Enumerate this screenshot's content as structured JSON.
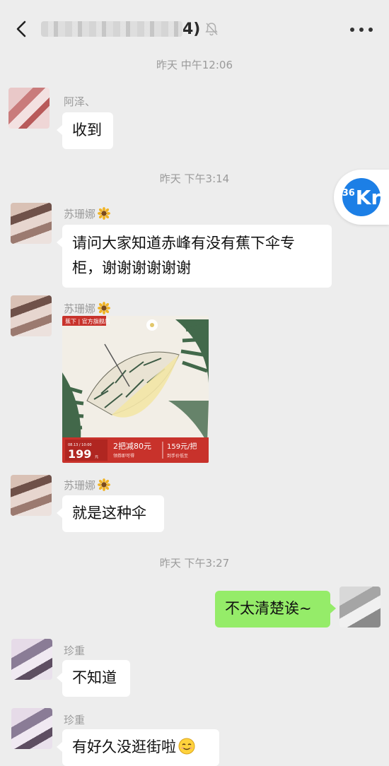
{
  "header": {
    "title_suffix": "4)",
    "icons": {
      "back": "chevron-left-icon",
      "mute": "bell-muted-icon",
      "more": "more-icon"
    }
  },
  "timestamps": [
    "昨天 中午12:06",
    "昨天 下午3:14",
    "昨天 下午3:27"
  ],
  "floating_badge": {
    "small": "36",
    "big": "Kr"
  },
  "messages": [
    {
      "sender": "阿泽、",
      "text": "收到"
    },
    {
      "sender": "苏珊娜",
      "text_line1": "请问大家知道赤峰有没有蕉下伞专",
      "text_line2": "柜，谢谢谢谢谢谢"
    },
    {
      "sender": "苏珊娜",
      "product": {
        "shop": "蕉下 | 官方旗舰店",
        "date": "08.13 / 10:00",
        "price": "199",
        "price_unit": "元",
        "promo": "2把减80元",
        "promo_sub": "领券即可得",
        "unit_price": "159元/把",
        "unit_price_sub": "到手价低至"
      }
    },
    {
      "sender": "苏珊娜",
      "text": "就是这种伞"
    },
    {
      "sender": "me",
      "text": "不太清楚诶~"
    },
    {
      "sender": "珍重",
      "text": "不知道"
    },
    {
      "sender": "珍重",
      "text": "有好久没逛街啦"
    }
  ],
  "colors": {
    "background": "#ededed",
    "my_bubble": "#95ec69",
    "badge": "#1c7fe6",
    "product_red": "#c8322b"
  }
}
